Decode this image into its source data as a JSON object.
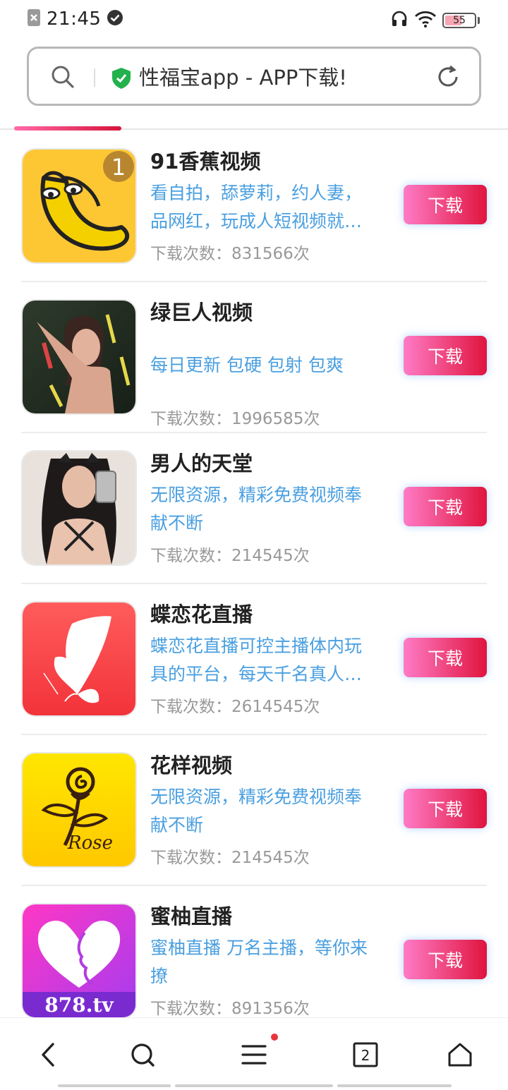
{
  "status_bar": {
    "time": "21:45",
    "battery": "55",
    "icons": [
      "notification-close-icon",
      "check-circle-icon",
      "headset-icon",
      "wifi-icon",
      "battery-icon"
    ]
  },
  "address_bar": {
    "title": "性福宝app - APP下载!",
    "secure_color": "#22b14c"
  },
  "accent": {
    "gradient_start": "#ff7bc6",
    "gradient_end": "#e0143e",
    "desc_color": "#4a9fe0"
  },
  "apps": [
    {
      "name": "91香蕉视频",
      "desc": "看自拍，舔萝莉，约人妻，品网红，玩成人短视频就…",
      "downloads": "下载次数：831566次",
      "button": "下载",
      "badge": "1"
    },
    {
      "name": "绿巨人视频",
      "desc": "每日更新 包硬 包射 包爽",
      "downloads": "下载次数：1996585次",
      "button": "下载"
    },
    {
      "name": "男人的天堂",
      "desc": "无限资源，精彩免费视频奉献不断",
      "downloads": "下载次数：214545次",
      "button": "下载"
    },
    {
      "name": "蝶恋花直播",
      "desc": "蝶恋花直播可控主播体内玩具的平台，每天千名真人…",
      "downloads": "下载次数：2614545次",
      "button": "下载"
    },
    {
      "name": "花样视频",
      "desc": "无限资源，精彩免费视频奉献不断",
      "downloads": "下载次数：214545次",
      "button": "下载",
      "icon_text": "Rose"
    },
    {
      "name": "蜜柚直播",
      "desc": "蜜柚直播 万名主播，等你来撩",
      "downloads": "下载次数：891356次",
      "button": "下载",
      "icon_text": "878.tv"
    }
  ],
  "bottom_nav": {
    "tab_count": "2",
    "icons": [
      "back-icon",
      "search-icon",
      "menu-icon",
      "tabs-icon",
      "home-icon"
    ]
  }
}
